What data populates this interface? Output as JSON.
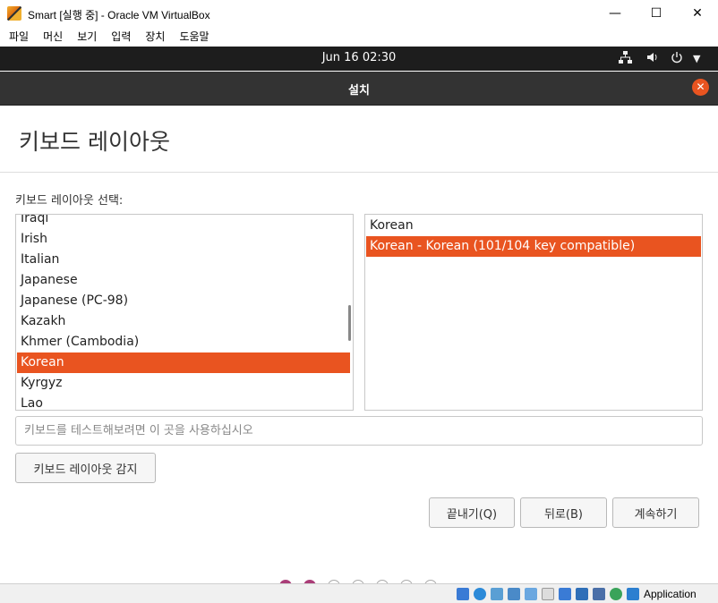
{
  "window": {
    "title": "Smart [실행 중] - Oracle VM VirtualBox",
    "minimize": "—",
    "maximize": "☐",
    "close": "✕"
  },
  "menu": [
    "파일",
    "머신",
    "보기",
    "입력",
    "장치",
    "도움말"
  ],
  "topbar": {
    "clock": "Jun 16  02:30",
    "icons": [
      "network-icon",
      "volume-icon",
      "power-icon",
      "dropdown-arrow-icon"
    ]
  },
  "installer": {
    "header_title": "설치",
    "close_glyph": "✕"
  },
  "page": {
    "title": "키보드 레이아웃",
    "layout_label": "키보드 레이아웃 선택:",
    "layouts": [
      "Iraqi",
      "Irish",
      "Italian",
      "Japanese",
      "Japanese (PC-98)",
      "Kazakh",
      "Khmer (Cambodia)",
      "Korean",
      "Kyrgyz",
      "Lao"
    ],
    "selected_layout": "Korean",
    "variants": [
      "Korean",
      "Korean - Korean (101/104 key compatible)"
    ],
    "selected_variant": "Korean - Korean (101/104 key compatible)",
    "test_placeholder": "키보드를 테스트해보려면 이 곳을 사용하십시오",
    "detect_button": "키보드 레이아웃 감지",
    "quit_button": "끝내기(Q)",
    "back_button": "뒤로(B)",
    "continue_button": "계속하기"
  },
  "progress": {
    "completed_steps": 2,
    "total_steps": 7
  },
  "statusbar": {
    "label": "Application"
  },
  "colors": {
    "accent": "#e95420",
    "header": "#333333",
    "topbar": "#1d1d1d",
    "dot": "#aa3d78"
  }
}
